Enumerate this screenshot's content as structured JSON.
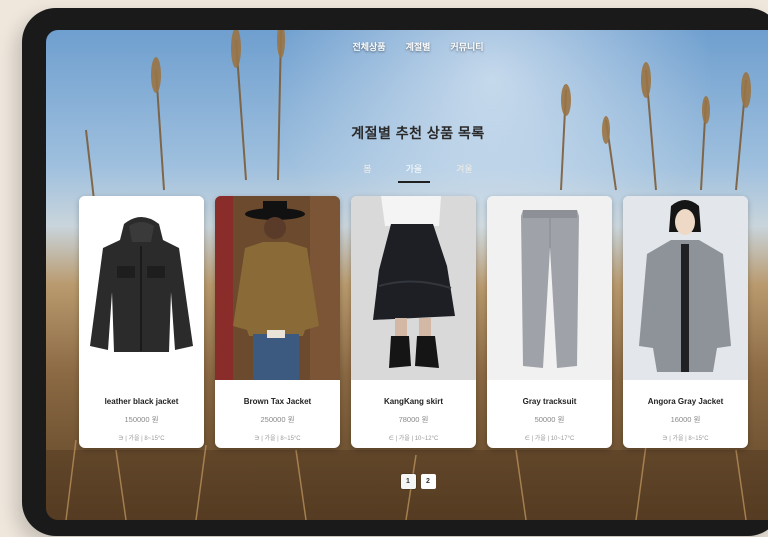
{
  "nav": {
    "items": [
      {
        "label": "전체상품"
      },
      {
        "label": "계절별"
      },
      {
        "label": "커뮤니티"
      }
    ]
  },
  "page": {
    "title": "계절별 추천 상품 목록"
  },
  "tabs": [
    {
      "label": "봄"
    },
    {
      "label": "가을",
      "active": true
    },
    {
      "label": "겨울"
    }
  ],
  "products": [
    {
      "name": "leather black jacket",
      "price": "150000 원",
      "meta": "∋ | 가을 | 8~15°C"
    },
    {
      "name": "Brown Tax Jacket",
      "price": "250000 원",
      "meta": "∋ | 가을 | 8~15°C"
    },
    {
      "name": "KangKang skirt",
      "price": "78000 원",
      "meta": "∈ | 가을 | 10~12°C"
    },
    {
      "name": "Gray tracksuit",
      "price": "50000 원",
      "meta": "∈ | 가을 | 10~17°C"
    },
    {
      "name": "Angora Gray Jacket",
      "price": "16000 원",
      "meta": "∋ | 가을 | 8~15°C"
    }
  ],
  "pagination": [
    "1",
    "2"
  ],
  "colors": {
    "sky": "#6f9fcf",
    "grass": "#8b6a44",
    "card": "#ffffff",
    "device": "#1a1a1a"
  }
}
